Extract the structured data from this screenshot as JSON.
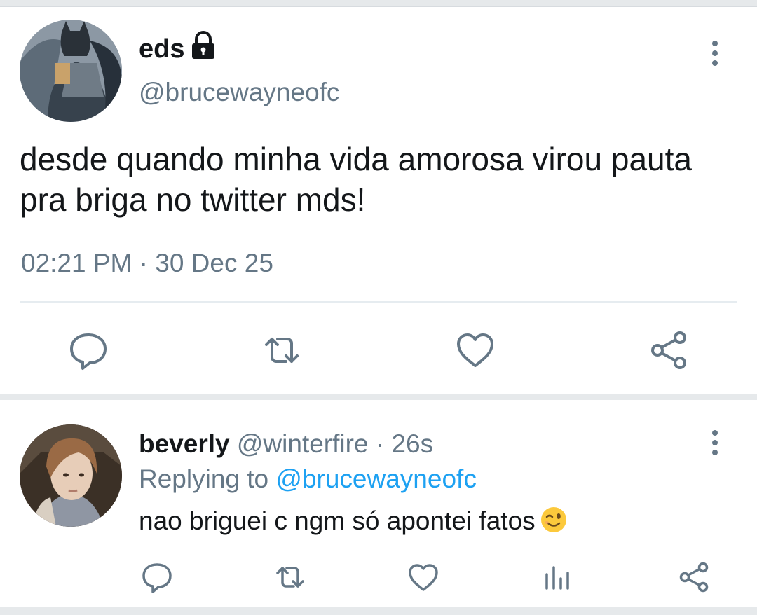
{
  "main_tweet": {
    "display_name": "eds",
    "handle": "@brucewayneofc",
    "text": "desde quando minha vida amorosa virou pauta pra briga no twitter mds!",
    "timestamp": "02:21 PM · 30 Dec 25",
    "icons": {
      "lock": "lock-icon",
      "more": "more-vertical-icon",
      "reply": "reply-icon",
      "retweet": "retweet-icon",
      "like": "heart-icon",
      "share": "share-icon"
    }
  },
  "reply_tweet": {
    "display_name": "beverly",
    "handle_and_time": "@winterfire · 26s",
    "replying_label": "Replying to",
    "replying_handle": "@brucewayneofc",
    "text": "nao briguei c ngm só apontei fatos",
    "emoji": "winking-face-emoji",
    "icons": {
      "more": "more-vertical-icon",
      "reply": "reply-icon",
      "retweet": "retweet-icon",
      "like": "heart-icon",
      "analytics": "analytics-icon",
      "share": "share-icon"
    }
  },
  "colors": {
    "text": "#14171a",
    "secondary": "#657786",
    "link": "#1da1f2",
    "icon": "#657786",
    "divider": "#e6e9eb"
  }
}
